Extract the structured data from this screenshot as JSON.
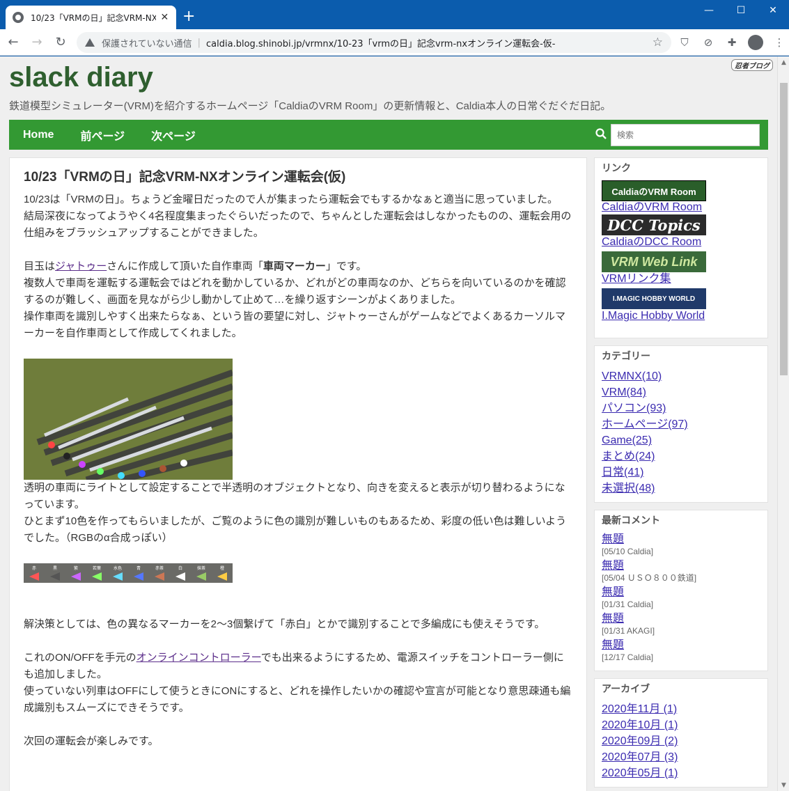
{
  "browser": {
    "tab_title": "10/23「VRMの日」記念VRM-NXオンライン運転会-仮-",
    "status": "保護されていない通信",
    "url": "caldia.blog.shinobi.jp/vrmnx/10-23「vrmの日」記念vrm-nxオンライン運転会-仮-"
  },
  "site": {
    "title": "slack diary",
    "description": "鉄道模型シミュレーター(VRM)を紹介するホームページ「CaldiaのVRM Room」の更新情報と、Caldia本人の日常ぐだぐだ日記。",
    "logo_text": "忍者ブログ"
  },
  "nav": {
    "home": "Home",
    "prev": "前ページ",
    "next": "次ページ",
    "search_placeholder": "検索"
  },
  "post": {
    "title": "10/23「VRMの日」記念VRM-NXオンライン運転会(仮)",
    "p1": "10/23は「VRMの日」。ちょうど金曜日だったので人が集まったら運転会でもするかなぁと適当に思っていました。",
    "p2": "結局深夜になってようやく4名程度集まったぐらいだったので、ちゃんとした運転会はしなかったものの、運転会用の仕組みをブラッシュアップすることができました。",
    "p3_a": "目玉は",
    "p3_link": "ジャトゥー",
    "p3_b": "さんに作成して頂いた自作車両「",
    "p3_bold": "車両マーカー",
    "p3_c": "」です。",
    "p4": "複数人で車両を運転する運転会ではどれを動かしているか、どれがどの車両なのか、どちらを向いているのかを確認するのが難しく、画面を見ながら少し動かして止めて…を繰り返すシーンがよくありました。",
    "p5": "操作車両を識別しやすく出来たらなぁ、という皆の要望に対し、ジャトゥーさんがゲームなどでよくあるカーソルマーカーを自作車両として作成してくれました。",
    "p6": "透明の車両にライトとして設定することで半透明のオブジェクトとなり、向きを変えると表示が切り替わるようになっています。",
    "p7": "ひとまず10色を作ってもらいましたが、ご覧のように色の識別が難しいものもあるため、彩度の低い色は難しいようでした。（RGBのα合成っぽい）",
    "p8": "解決策としては、色の異なるマーカーを2〜3個繋げて「赤白」とかで識別することで多編成にも使えそうです。",
    "p9_a": "これのON/OFFを手元の",
    "p9_link": "オンラインコントローラー",
    "p9_b": "でも出来るようにするため、電源スイッチをコントローラー側にも追加しました。",
    "p10": "使っていない列車はOFFにして使うときにONにすると、どれを操作したいかの確認や宣言が可能となり意思疎通も編成識別もスムーズにできそうです。",
    "p11": "次回の運転会が楽しみです。",
    "strip_labels": [
      "赤",
      "黒",
      "紫",
      "若葉",
      "水色",
      "青",
      "赤茶",
      "白",
      "抹茶",
      "橙"
    ]
  },
  "sidebar": {
    "links_title": "リンク",
    "links": [
      {
        "banner": "CaldiaのVRM Room",
        "label": "CaldiaのVRM Room"
      },
      {
        "banner": "DCC Topics",
        "label": "CaldiaのDCC Room"
      },
      {
        "banner": "VRM Web Link",
        "label": "VRMリンク集"
      },
      {
        "banner": "I.MAGIC HOBBY WORLD",
        "label": "I.Magic Hobby World"
      }
    ],
    "categories_title": "カテゴリー",
    "categories": [
      "VRMNX(10)",
      "VRM(84)",
      "パソコン(93)",
      "ホームページ(97)",
      "Game(25)",
      "まとめ(24)",
      "日常(41)",
      "未選択(48)"
    ],
    "comments_title": "最新コメント",
    "comments": [
      {
        "title": "無題",
        "meta": "[05/10 Caldia]"
      },
      {
        "title": "無題",
        "meta": "[05/04 ＵＳＯ８００鉄道]"
      },
      {
        "title": "無題",
        "meta": "[01/31 Caldia]"
      },
      {
        "title": "無題",
        "meta": "[01/31 AKAGI]"
      },
      {
        "title": "無題",
        "meta": "[12/17 Caldia]"
      }
    ],
    "archive_title": "アーカイブ",
    "archive": [
      "2020年11月 (1)",
      "2020年10月 (1)",
      "2020年09月 (2)",
      "2020年07月 (3)",
      "2020年05月 (1)"
    ]
  }
}
